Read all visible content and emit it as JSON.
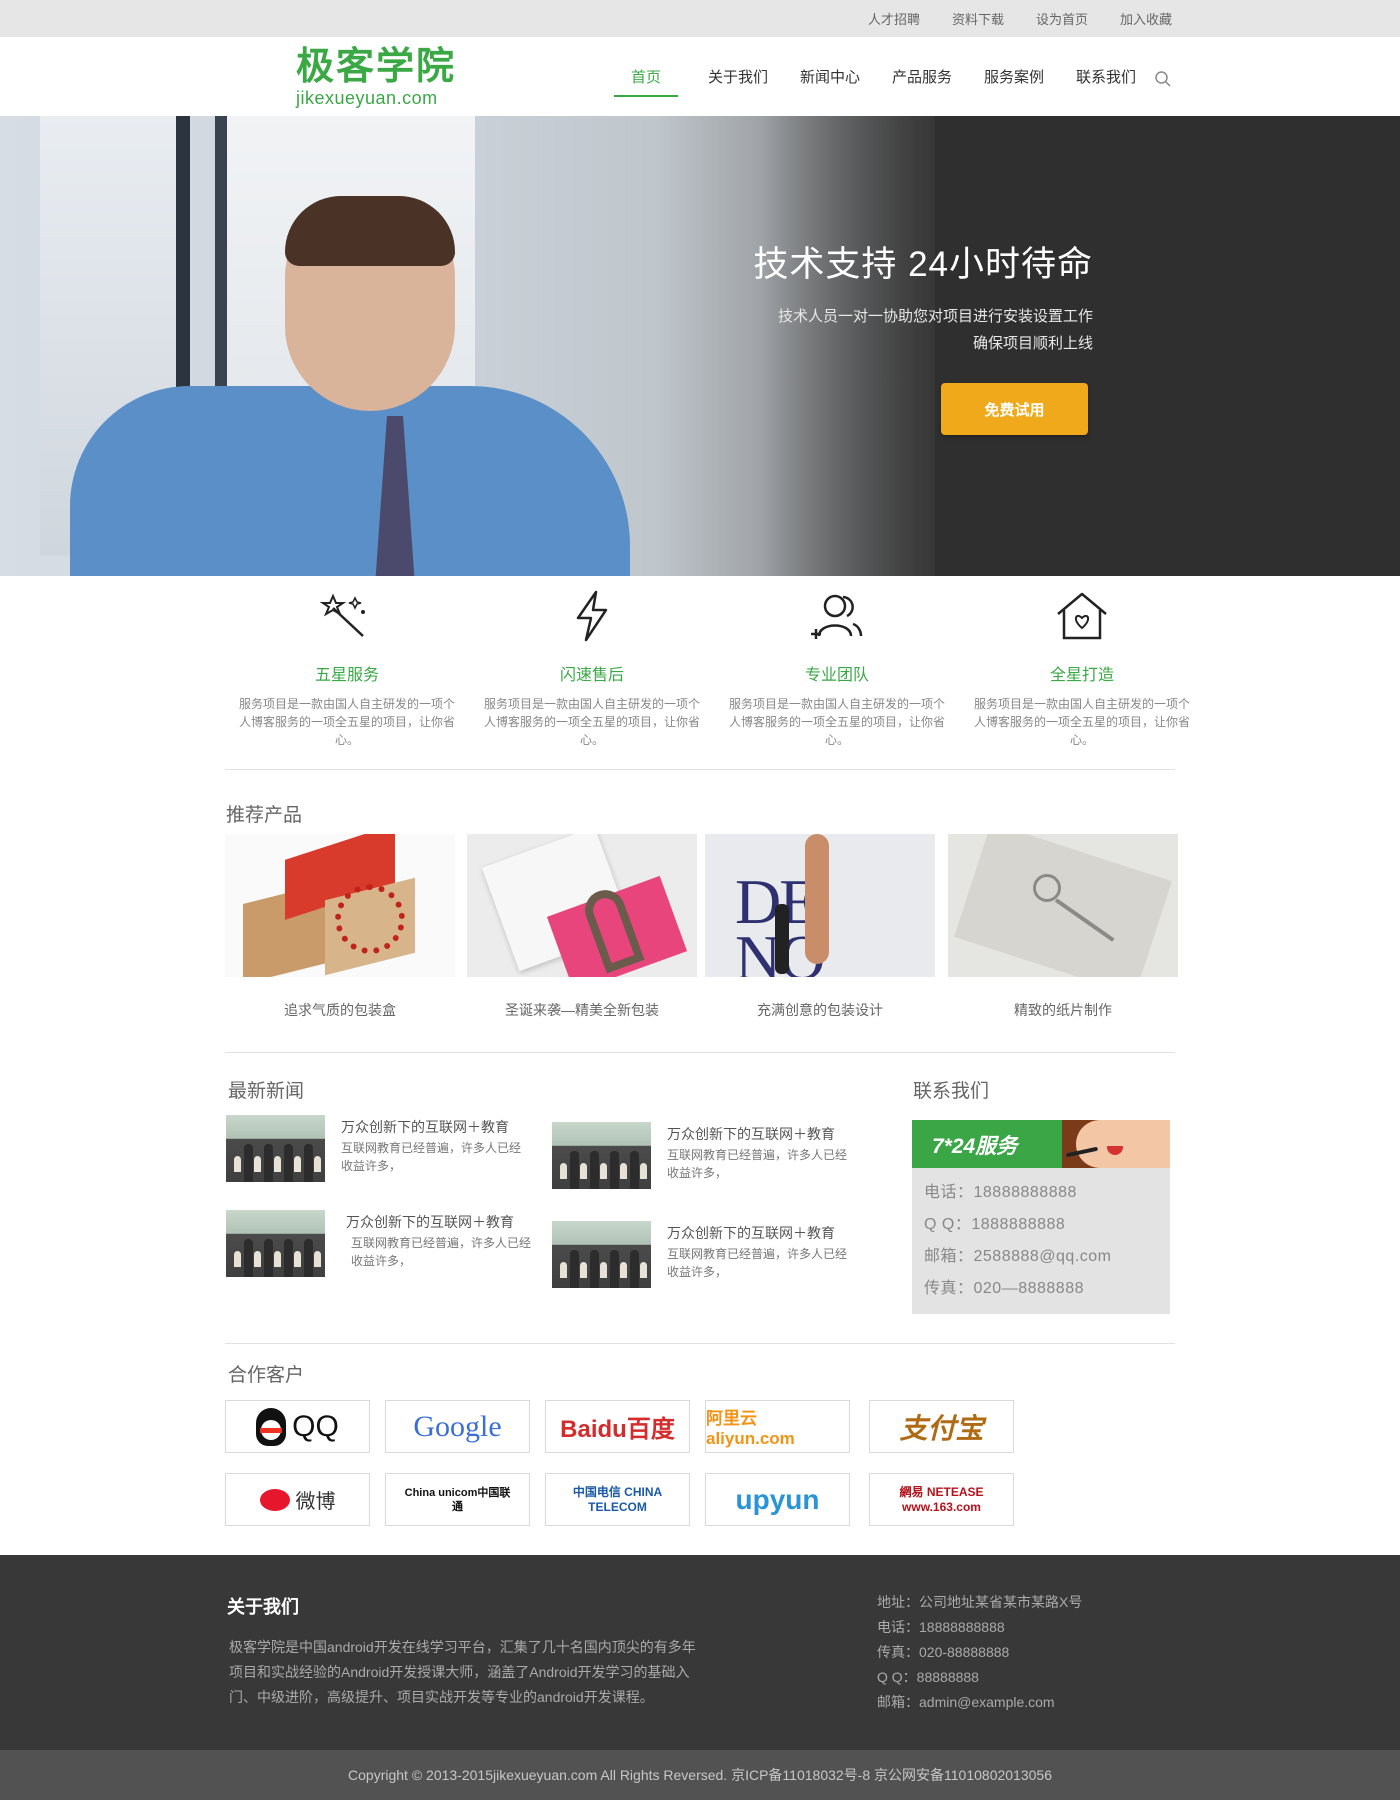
{
  "topbar": {
    "links": [
      "人才招聘",
      "资料下载",
      "设为首页",
      "加入收藏"
    ]
  },
  "header": {
    "logo_cn": "极客学院",
    "logo_en": "jikexueyuan.com",
    "nav": [
      "首页",
      "关于我们",
      "新闻中心",
      "产品服务",
      "服务案例",
      "联系我们"
    ],
    "active_nav": "首页"
  },
  "hero": {
    "title": "技术支持 24小时待命",
    "sub_line1": "技术人员一对一协助您对项目进行安装设置工作",
    "sub_line2": "确保项目顺利上线",
    "cta": "免费试用"
  },
  "features": [
    {
      "icon": "magic-wand-icon",
      "title": "五星服务",
      "desc": "服务项目是一款由国人自主研发的一项个人博客服务的一项全五星的项目，让你省心。"
    },
    {
      "icon": "lightning-icon",
      "title": "闪速售后",
      "desc": "服务项目是一款由国人自主研发的一项个人博客服务的一项全五星的项目，让你省心。"
    },
    {
      "icon": "team-icon",
      "title": "专业团队",
      "desc": "服务项目是一款由国人自主研发的一项个人博客服务的一项全五星的项目，让你省心。"
    },
    {
      "icon": "home-heart-icon",
      "title": "全星打造",
      "desc": "服务项目是一款由国人自主研发的一项个人博客服务的一项全五星的项目，让你省心。"
    }
  ],
  "products": {
    "title": "推荐产品",
    "items": [
      {
        "caption": "追求气质的包装盒"
      },
      {
        "caption": "圣诞来袭—精美全新包装"
      },
      {
        "caption": "充满创意的包装设计"
      },
      {
        "caption": "精致的纸片制作"
      }
    ]
  },
  "news": {
    "title": "最新新闻",
    "items": [
      {
        "title": "万众创新下的互联网＋教育",
        "desc": "互联网教育已经普遍，许多人已经收益许多，"
      },
      {
        "title": "万众创新下的互联网＋教育",
        "desc": "互联网教育已经普遍，许多人已经收益许多，"
      },
      {
        "title": "万众创新下的互联网＋教育",
        "desc": "互联网教育已经普遍，许多人已经收益许多，"
      },
      {
        "title": "万众创新下的互联网＋教育",
        "desc": "互联网教育已经普遍，许多人已经收益许多，"
      }
    ]
  },
  "contact": {
    "title": "联系我们",
    "banner": "7*24服务",
    "phone": "电话：18888888888",
    "qq": "Q Q：1888888888",
    "email": "邮箱：2588888@qq.com",
    "fax": "传真：020—8888888"
  },
  "partners": {
    "title": "合作客户",
    "logos": [
      "QQ",
      "Google",
      "Baidu百度",
      "阿里云 aliyun.com",
      "支付宝",
      "微博",
      "China unicom中国联通",
      "中国电信 CHINA TELECOM",
      "upyun",
      "網易 NETEASE www.163.com"
    ]
  },
  "footer": {
    "about_title": "关于我们",
    "about_text": "极客学院是中国android开发在线学习平台，汇集了几十名国内顶尖的有多年项目和实战经验的Android开发授课大师，涵盖了Android开发学习的基础入门、中级进阶，高级提升、项目实战开发等专业的android开发课程。",
    "address": "地址：公司地址某省某市某路X号",
    "phone": "电话：18888888888",
    "fax": "传真：020-88888888",
    "qq": "Q Q：88888888",
    "email": "邮箱：admin@example.com",
    "copyright": "Copyright © 2013-2015jikexueyuan.com All Rights Reversed. 京ICP备11018032号-8 京公网安备11010802013056"
  },
  "colors": {
    "brand_green": "#3aa845",
    "cta_orange": "#f0a91a",
    "footer_dark": "#383838"
  }
}
